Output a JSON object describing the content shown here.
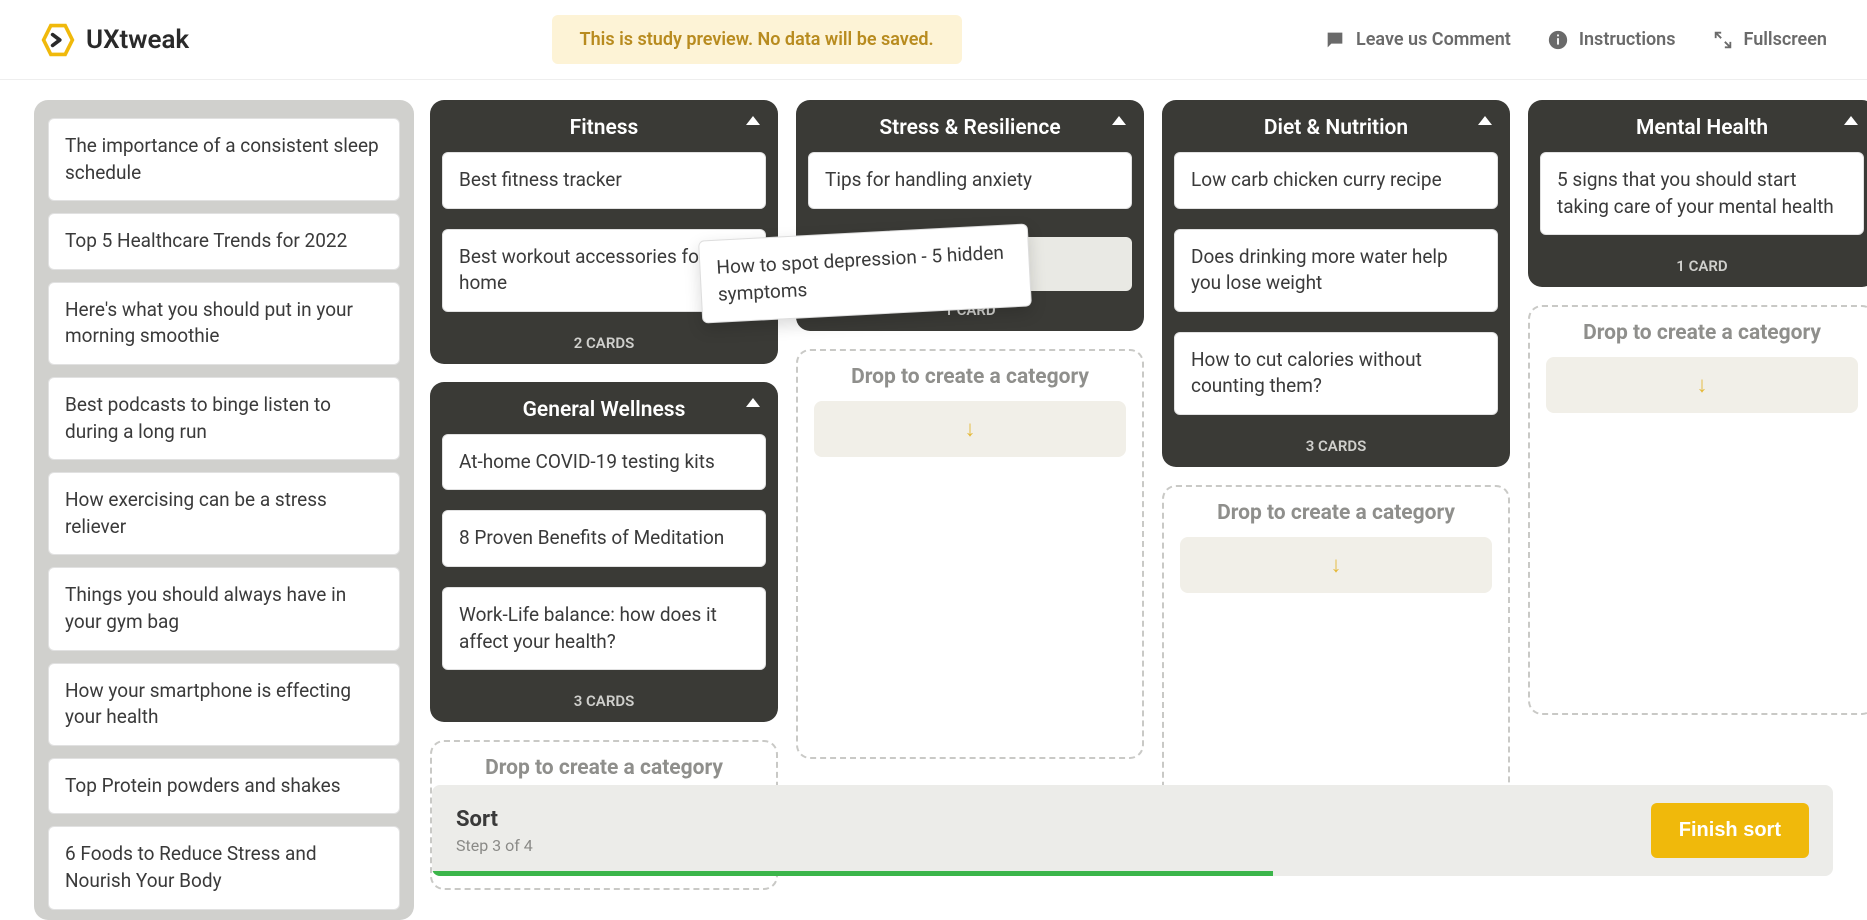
{
  "brand": {
    "name": "UXtweak"
  },
  "preview_banner": "This is study preview. No data will be saved.",
  "top_actions": {
    "comment": "Leave us Comment",
    "instructions": "Instructions",
    "fullscreen": "Fullscreen"
  },
  "unsorted": [
    "The importance of a consistent sleep schedule",
    "Top 5 Healthcare Trends for 2022",
    "Here's what you should put in your morning smoothie",
    "Best podcasts to binge listen to during a long run",
    "How exercising can be a stress reliever",
    "Things you should always have in your gym bag",
    "How your smartphone is effecting your health",
    "Top Protein powders and shakes",
    "6 Foods to Reduce Stress and Nourish Your Body"
  ],
  "drop_label": "Drop to create a category",
  "dragging_card": "How to spot depression - 5 hidden symptoms",
  "columns": [
    {
      "categories": [
        {
          "title": "Fitness",
          "cards": [
            "Best fitness tracker",
            "Best workout accessories for home"
          ],
          "count_label": "2 CARDS"
        },
        {
          "title": "General Wellness",
          "cards": [
            "At-home COVID-19 testing kits",
            "8 Proven Benefits of Meditation",
            "Work-Life balance: how does it affect your health?"
          ],
          "count_label": "3 CARDS"
        }
      ],
      "dropzone_height": "short"
    },
    {
      "categories": [
        {
          "title": "Stress & Resilience",
          "cards": [
            "Tips for handling anxiety"
          ],
          "count_label": "1 CARD",
          "has_placeholder": true
        }
      ],
      "dropzone_height": "tall"
    },
    {
      "categories": [
        {
          "title": "Diet & Nutrition",
          "cards": [
            "Low carb chicken curry recipe",
            "Does drinking more water help you lose weight",
            "How to cut calories without counting them?"
          ],
          "count_label": "3 CARDS"
        }
      ],
      "dropzone_height": "medium"
    },
    {
      "categories": [
        {
          "title": "Mental Health",
          "cards": [
            "5 signs that you should start taking care of your mental health"
          ],
          "count_label": "1 CARD"
        }
      ],
      "dropzone_height": "tall"
    }
  ],
  "bottom": {
    "title": "Sort",
    "step": "Step 3 of 4",
    "finish": "Finish sort",
    "progress_percent": 60
  }
}
